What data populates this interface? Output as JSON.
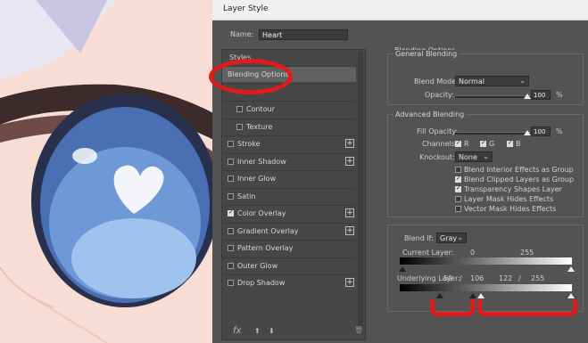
{
  "window": {
    "title": "Layer Style"
  },
  "name_field": {
    "label": "Name:",
    "value": "Heart"
  },
  "styles": {
    "title": "Styles",
    "items": [
      {
        "label": "Blending Options",
        "checkbox": false,
        "checked": false,
        "plus": false,
        "selected": true
      },
      {
        "label": "",
        "checkbox": false,
        "checked": false,
        "plus": false,
        "selected": false
      },
      {
        "label": "Contour",
        "checkbox": true,
        "checked": false,
        "plus": false,
        "sub": true
      },
      {
        "label": "Texture",
        "checkbox": true,
        "checked": false,
        "plus": false,
        "sub": true
      },
      {
        "label": "Stroke",
        "checkbox": true,
        "checked": false,
        "plus": true
      },
      {
        "label": "Inner Shadow",
        "checkbox": true,
        "checked": false,
        "plus": true
      },
      {
        "label": "Inner Glow",
        "checkbox": true,
        "checked": false,
        "plus": false
      },
      {
        "label": "Satin",
        "checkbox": true,
        "checked": false,
        "plus": false
      },
      {
        "label": "Color Overlay",
        "checkbox": true,
        "checked": true,
        "plus": true
      },
      {
        "label": "Gradient Overlay",
        "checkbox": true,
        "checked": false,
        "plus": true
      },
      {
        "label": "Pattern Overlay",
        "checkbox": true,
        "checked": false,
        "plus": false
      },
      {
        "label": "Outer Glow",
        "checkbox": true,
        "checked": false,
        "plus": false
      },
      {
        "label": "Drop Shadow",
        "checkbox": true,
        "checked": false,
        "plus": true
      }
    ],
    "bottom": {
      "fx": "fx",
      "up": "⬆",
      "down": "⬇",
      "trash": "🗑"
    }
  },
  "blending": {
    "title": "Blending Options",
    "general": {
      "title": "General Blending",
      "blend_mode_label": "Blend Mode:",
      "blend_mode": "Normal",
      "opacity_label": "Opacity:",
      "opacity": "100",
      "opacity_level": 1.0,
      "pct": "%"
    },
    "advanced": {
      "title": "Advanced Blending",
      "fill_label": "Fill Opacity:",
      "fill": "100",
      "fill_level": 1.0,
      "pct": "%",
      "channels_label": "Channels:",
      "channels": [
        "R",
        "G",
        "B"
      ],
      "knockout_label": "Knockout:",
      "knockout": "None",
      "options": [
        {
          "label": "Blend Interior Effects as Group",
          "checked": false
        },
        {
          "label": "Blend Clipped Layers as Group",
          "checked": true
        },
        {
          "label": "Transparency Shapes Layer",
          "checked": true
        },
        {
          "label": "Layer Mask Hides Effects",
          "checked": false
        },
        {
          "label": "Vector Mask Hides Effects",
          "checked": false
        }
      ]
    },
    "blend_if": {
      "label": "Blend If:",
      "value": "Gray",
      "current_label": "Current Layer:",
      "current_low": "0",
      "current_high": "255",
      "underlying_label": "Underlying Layer:",
      "underlying_vals": [
        "59",
        "/",
        "106",
        "122",
        "/",
        "255"
      ]
    }
  },
  "colors": {
    "panel": "#535353",
    "annotation": "#e01b1b"
  }
}
